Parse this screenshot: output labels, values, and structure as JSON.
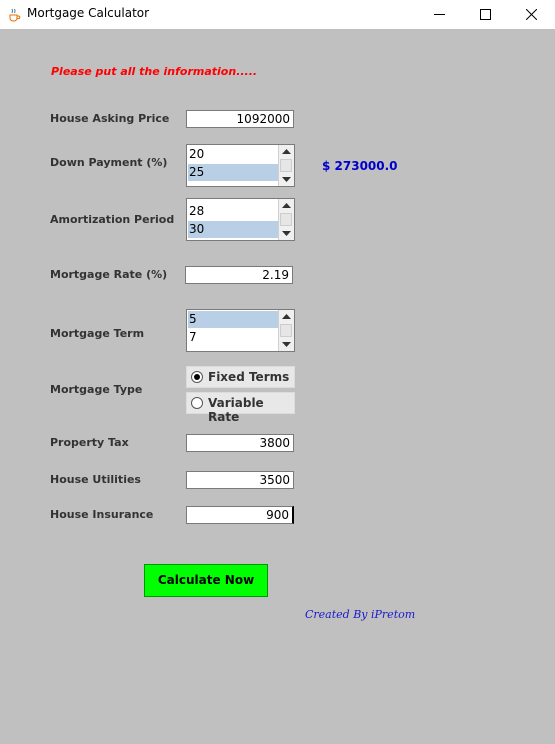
{
  "window": {
    "title": "Mortgage Calculator",
    "icon": "java-cup-icon",
    "controls": [
      "minimize-icon",
      "maximize-icon",
      "close-icon"
    ]
  },
  "form": {
    "instruction": "Please put all the information.....",
    "house_asking_price": {
      "label": "House Asking Price",
      "value": "1092000"
    },
    "down_payment": {
      "label": "Down Payment (%)",
      "items": [
        "20",
        "25"
      ],
      "selected": "25",
      "amount": "$ 273000.0"
    },
    "amortization_period": {
      "label": "Amortization Period",
      "items": [
        "28",
        "30"
      ],
      "selected": "30"
    },
    "mortgage_rate": {
      "label": "Mortgage Rate (%)",
      "value": "2.19"
    },
    "mortgage_term": {
      "label": "Mortgage Term",
      "items": [
        "5",
        "7"
      ],
      "selected": "5"
    },
    "mortgage_type": {
      "label": "Mortgage Type",
      "options": [
        "Fixed Terms",
        "Variable Rate"
      ],
      "selected": "Fixed Terms"
    },
    "property_tax": {
      "label": "Property Tax",
      "value": "3800"
    },
    "house_utilities": {
      "label": "House Utilities",
      "value": "3500"
    },
    "house_insurance": {
      "label": "House Insurance",
      "value": "900"
    }
  },
  "actions": {
    "calculate_label": "Calculate Now"
  },
  "credit": "Created By iPretom",
  "colors": {
    "background": "#c0c0c0",
    "instruction": "#ff0000",
    "amount": "#0000cc",
    "calculate_button": "#00ff00",
    "selection": "#b8cfe5",
    "credit": "#1a1acc"
  }
}
